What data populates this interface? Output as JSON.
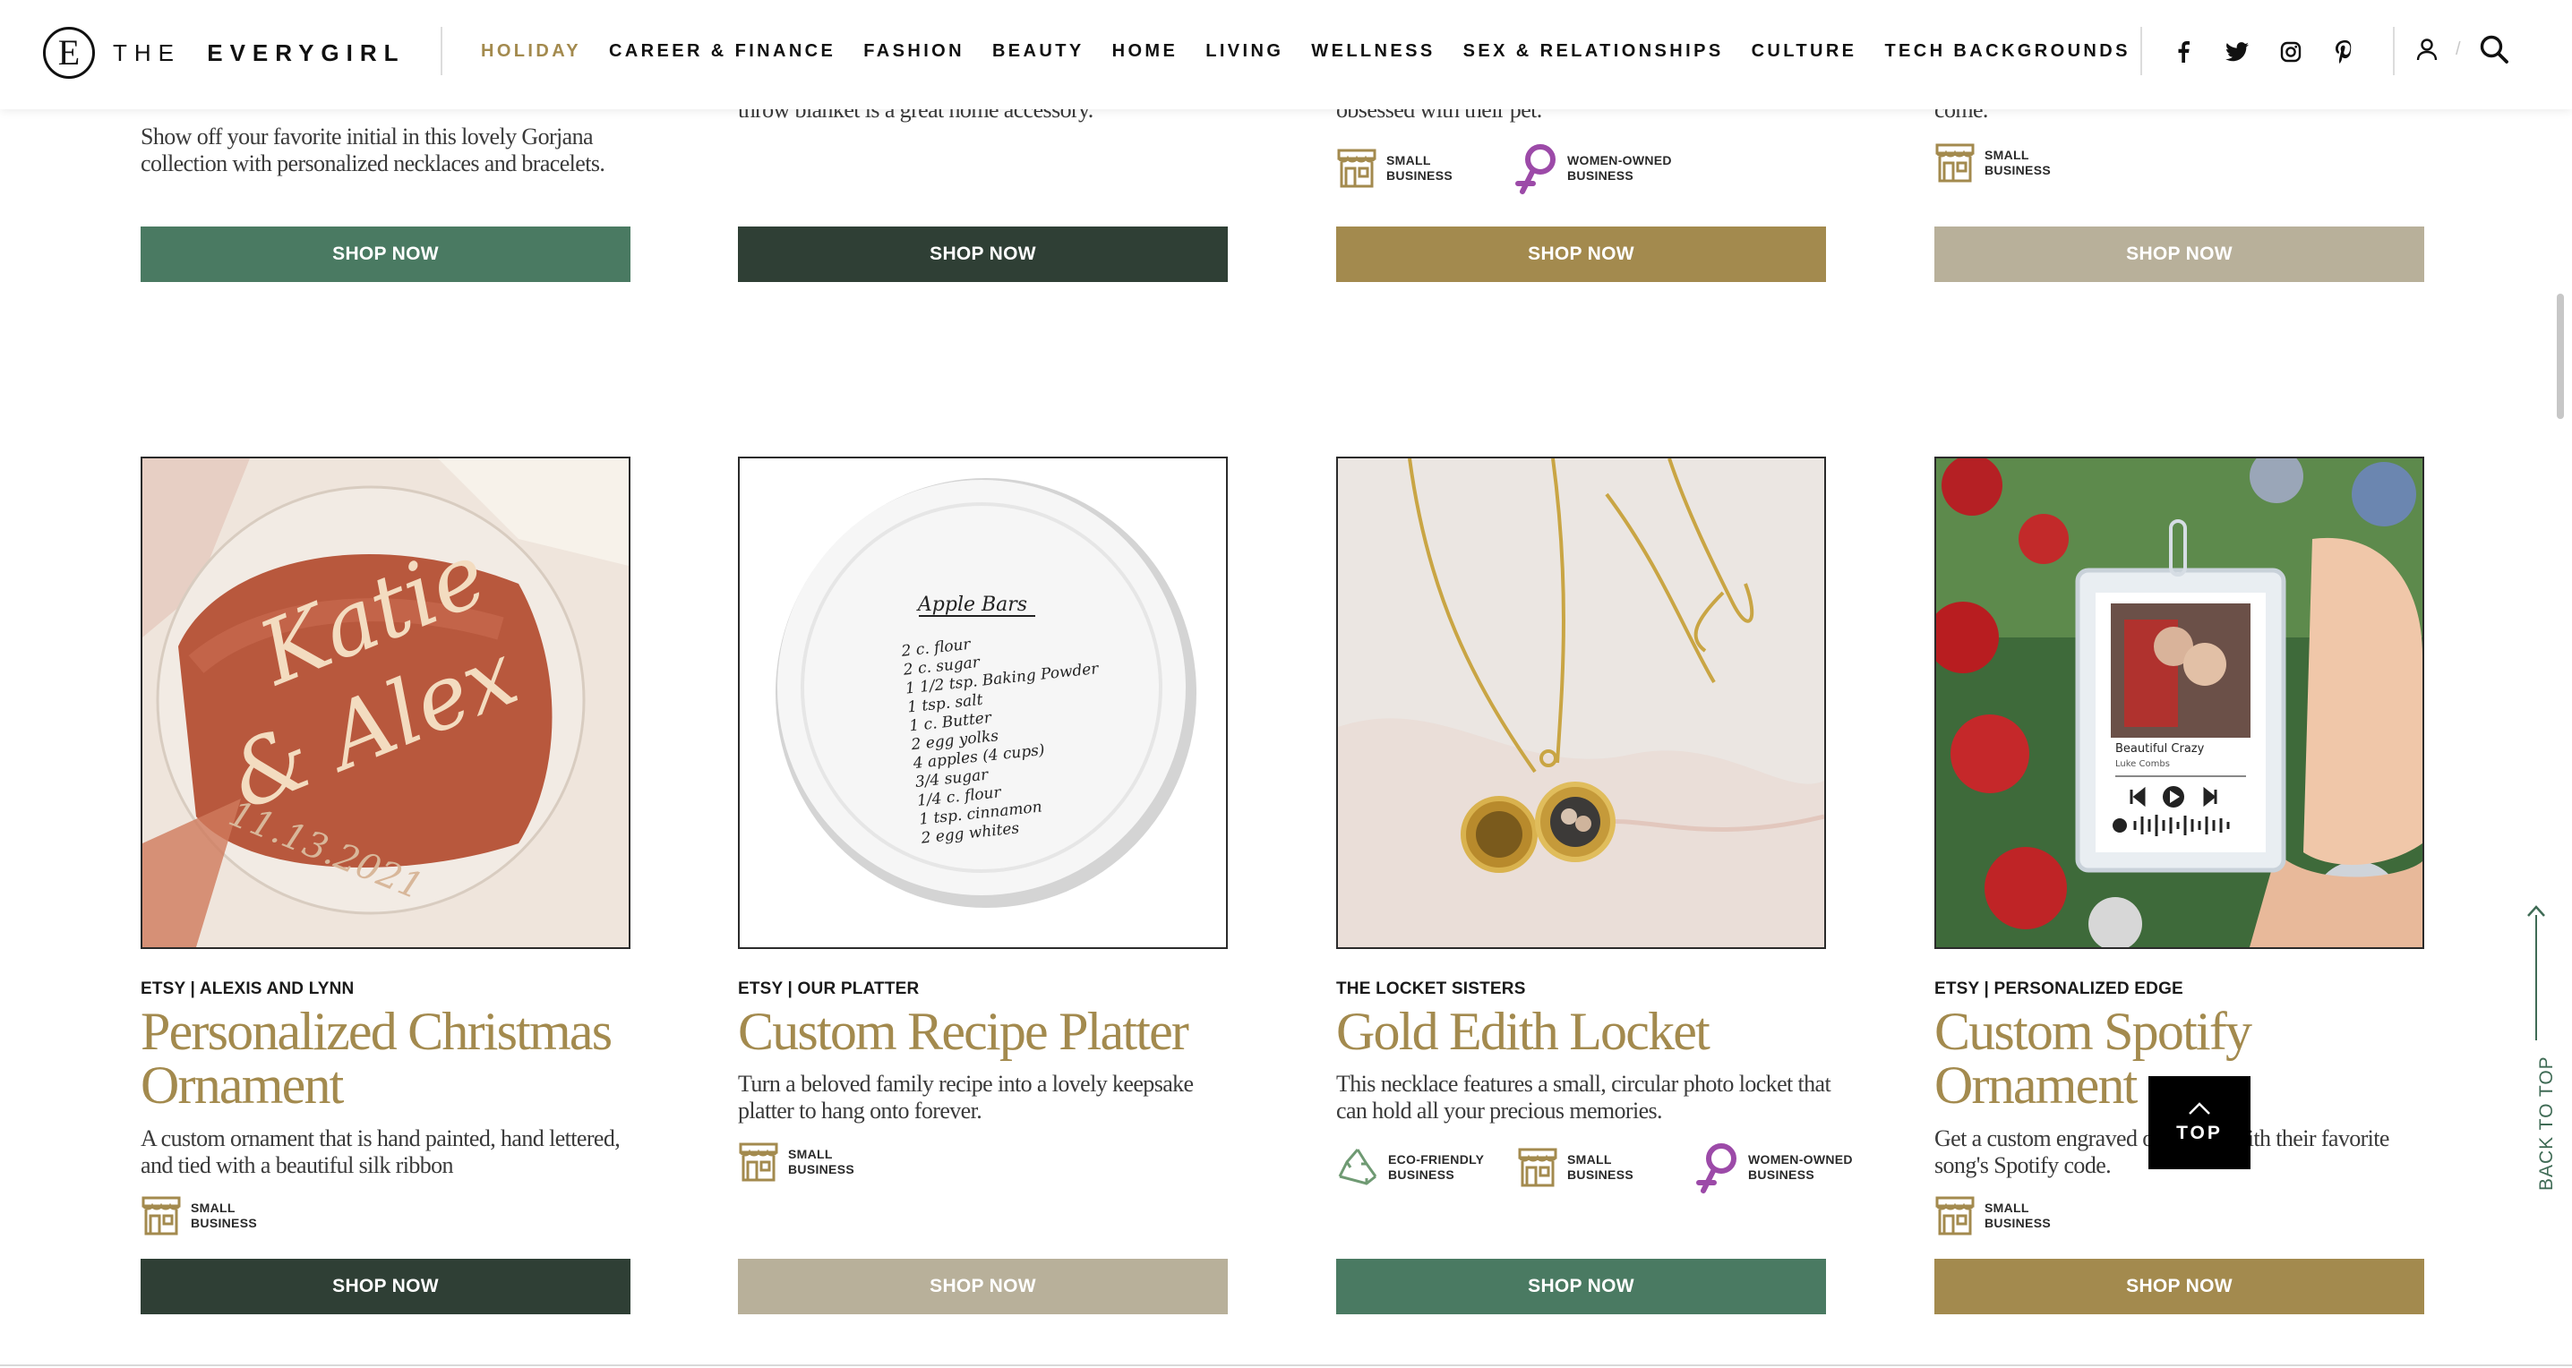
{
  "header": {
    "logo_letter": "E",
    "logo_text_the": "THE",
    "logo_text_name": "EVERYGIRL",
    "nav": [
      "HOLIDAY",
      "CAREER & FINANCE",
      "FASHION",
      "BEAUTY",
      "HOME",
      "LIVING",
      "WELLNESS",
      "SEX & RELATIONSHIPS",
      "CULTURE",
      "TECH BACKGROUNDS"
    ],
    "active_nav": "HOLIDAY",
    "social_icons": [
      "facebook-icon",
      "twitter-icon",
      "instagram-icon",
      "pinterest-icon"
    ],
    "util_icons": [
      "account-icon",
      "search-icon"
    ],
    "slash": "/"
  },
  "colors": {
    "accent_gold": "#a38a4e",
    "green": "#4a7a62",
    "dark_green": "#2f3f35",
    "mustard": "#a38a4e",
    "taupe": "#b8b09a"
  },
  "top_row": [
    {
      "desc": "Show off your favorite initial in this lovely Gorjana collection with personalized necklaces and bracelets.",
      "badges": [],
      "button": "SHOP NOW",
      "button_color": "#4a7a62"
    },
    {
      "desc": "throw blanket is a great home accessory.",
      "badges": [],
      "button": "SHOP NOW",
      "button_color": "#2f3f35"
    },
    {
      "desc": "obsessed with their pet.",
      "badges": [
        {
          "icon": "storefront-icon",
          "label": "SMALL BUSINESS"
        },
        {
          "icon": "women-owned-icon",
          "label": "WOMEN-OWNED BUSINESS"
        }
      ],
      "button": "SHOP NOW",
      "button_color": "#a38a4e"
    },
    {
      "desc": "come.",
      "badges": [
        {
          "icon": "storefront-icon",
          "label": "SMALL BUSINESS"
        }
      ],
      "button": "SHOP NOW",
      "button_color": "#b8b09a"
    }
  ],
  "products": [
    {
      "brand": "ETSY | ALEXIS AND LYNN",
      "title": "Personalized Christmas Ornament",
      "desc": "A custom ornament that is hand painted, hand lettered, and tied with a beautiful silk ribbon",
      "badges": [
        {
          "icon": "storefront-icon",
          "label": "SMALL BUSINESS"
        }
      ],
      "button": "SHOP NOW",
      "button_color": "#2f3f35",
      "image": {
        "name_line1": "Katie",
        "name_line2": "& Alex",
        "date": "11.13.2021"
      }
    },
    {
      "brand": "ETSY | OUR PLATTER",
      "title": "Custom Recipe Platter",
      "desc": "Turn a beloved family recipe into a lovely keepsake platter to hang onto forever.",
      "badges": [
        {
          "icon": "storefront-icon",
          "label": "SMALL BUSINESS"
        }
      ],
      "button": "SHOP NOW",
      "button_color": "#b8b09a",
      "image": {
        "recipe_title": "Apple Bars",
        "recipe_lines": [
          "2 c. flour",
          "2 c. sugar",
          "1 1/2 tsp. Baking Powder",
          "1 tsp. salt",
          "1 c. Butter",
          "2 egg yolks",
          "4 apples (4 cups)",
          "3/4 sugar",
          "1/4 c. flour",
          "1 tsp. cinnamon",
          "2 egg whites"
        ]
      }
    },
    {
      "brand": "THE LOCKET SISTERS",
      "title": "Gold Edith Locket",
      "desc": "This necklace features a small, circular photo locket that can hold all your precious memories.",
      "badges": [
        {
          "icon": "eco-friendly-icon",
          "label": "ECO-FRIENDLY BUSINESS"
        },
        {
          "icon": "storefront-icon",
          "label": "SMALL BUSINESS"
        },
        {
          "icon": "women-owned-icon",
          "label": "WOMEN-OWNED BUSINESS"
        }
      ],
      "button": "SHOP NOW",
      "button_color": "#4a7a62",
      "image": {}
    },
    {
      "brand": "ETSY | PERSONALIZED EDGE",
      "title": "Custom Spotify Ornament",
      "desc": "Get a custom engraved ornament with their favorite song's Spotify code.",
      "badges": [
        {
          "icon": "storefront-icon",
          "label": "SMALL BUSINESS"
        }
      ],
      "button": "SHOP NOW",
      "button_color": "#a38a4e",
      "image": {
        "song": "Beautiful Crazy",
        "artist": "Luke Combs"
      }
    }
  ],
  "top_button": "TOP",
  "back_to_top": "BACK TO TOP"
}
